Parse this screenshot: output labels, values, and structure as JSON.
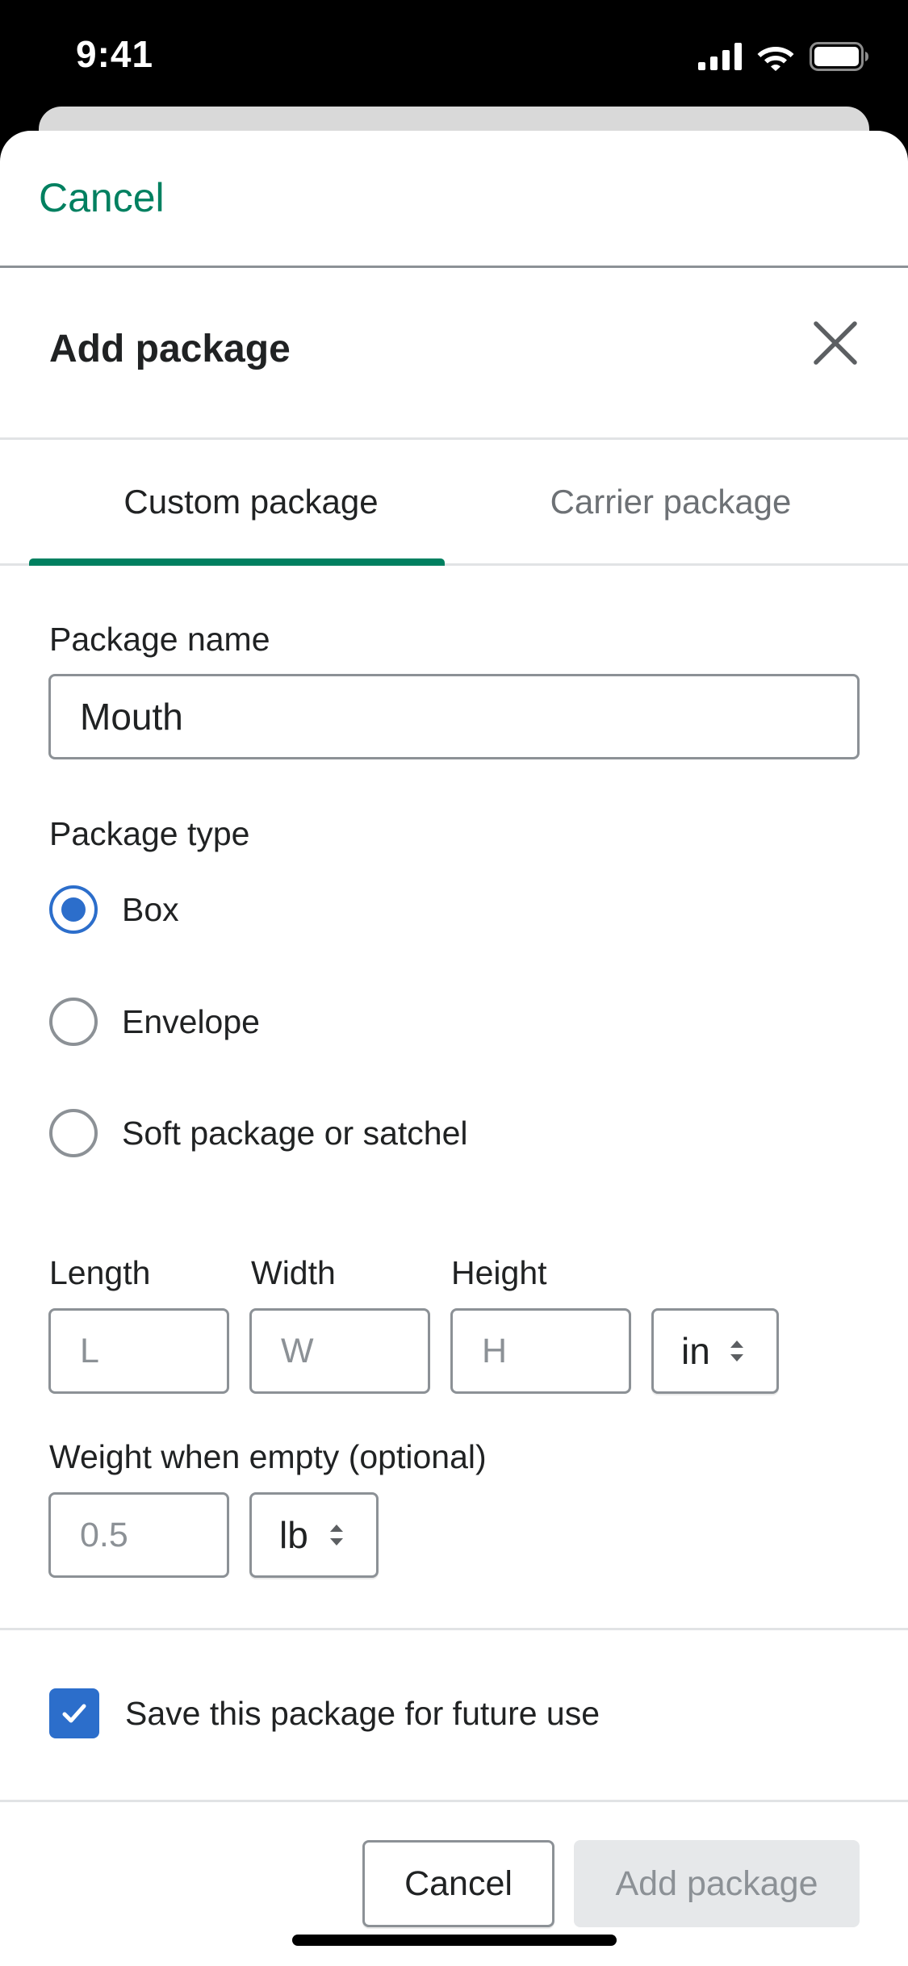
{
  "status_bar": {
    "time": "9:41"
  },
  "nav": {
    "cancel_label": "Cancel"
  },
  "modal": {
    "title": "Add package"
  },
  "tabs": [
    {
      "label": "Custom package",
      "selected": true
    },
    {
      "label": "Carrier package",
      "selected": false
    }
  ],
  "package_name": {
    "label": "Package name",
    "value": "Mouth"
  },
  "package_type": {
    "label": "Package type",
    "options": [
      {
        "label": "Box",
        "selected": true
      },
      {
        "label": "Envelope",
        "selected": false
      },
      {
        "label": "Soft package or satchel",
        "selected": false
      }
    ]
  },
  "dimensions": {
    "length_label": "Length",
    "length_placeholder": "L",
    "width_label": "Width",
    "width_placeholder": "W",
    "height_label": "Height",
    "height_placeholder": "H",
    "unit": "in"
  },
  "weight": {
    "label": "Weight when empty (optional)",
    "placeholder": "0.5",
    "unit": "lb"
  },
  "save_option": {
    "label": "Save this package for future use",
    "checked": true
  },
  "footer": {
    "cancel_label": "Cancel",
    "add_label": "Add package"
  },
  "colors": {
    "accent_green": "#008060",
    "interactive_blue": "#2c6ecb",
    "border_gray": "#8c9196",
    "disabled_bg": "#e6e8ea"
  }
}
